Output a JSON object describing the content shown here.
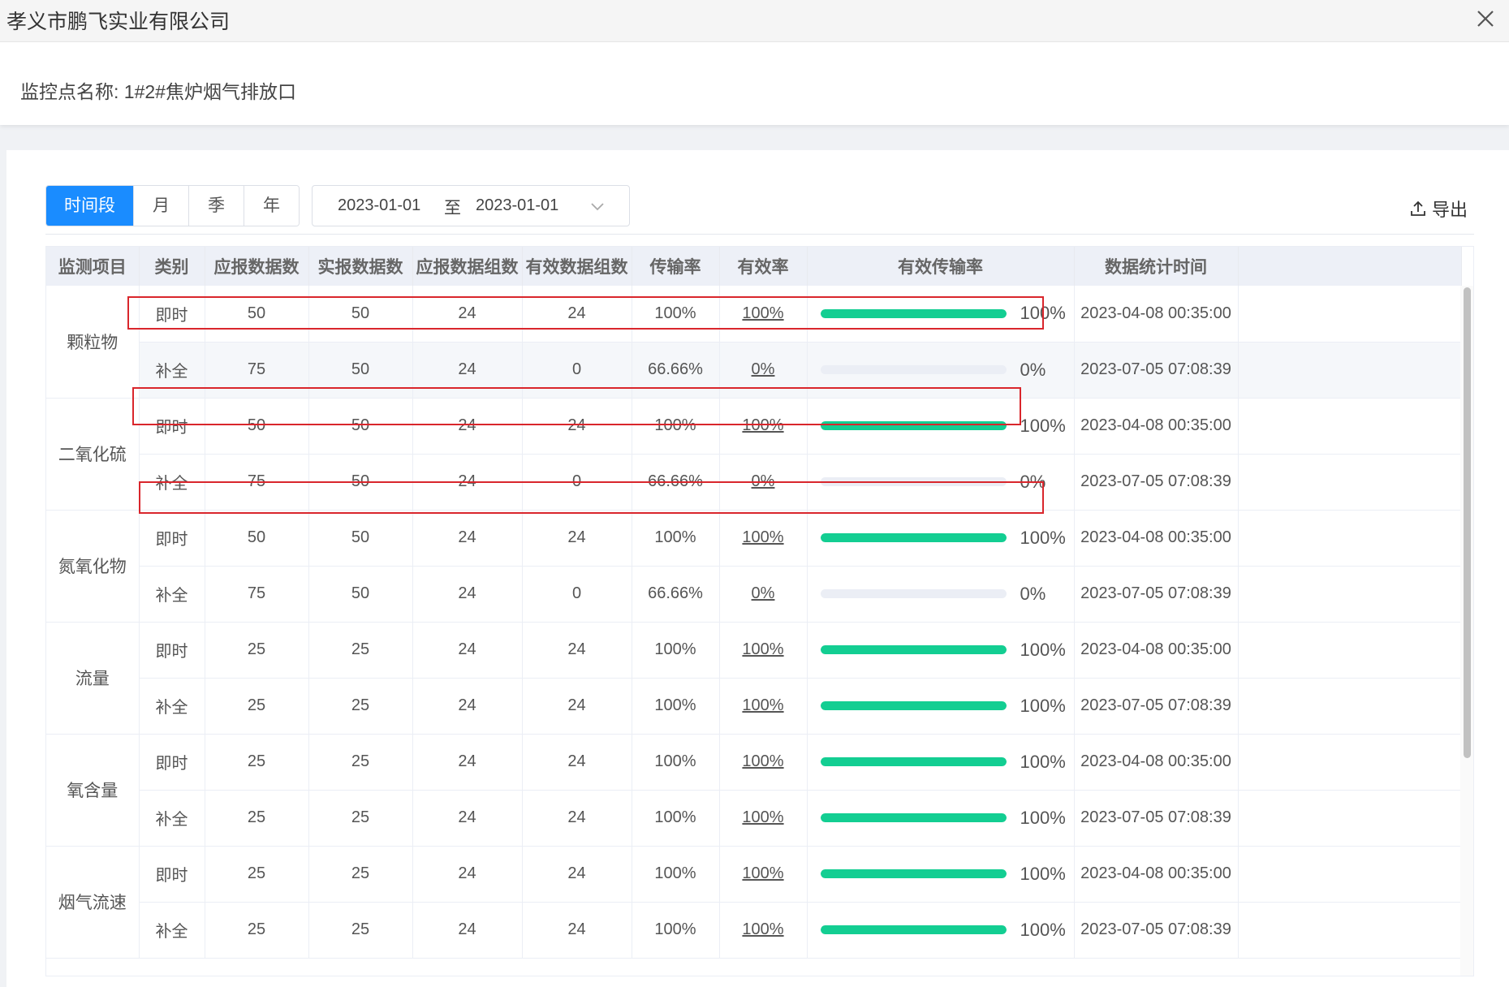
{
  "window": {
    "title": "孝义市鹏飞实业有限公司"
  },
  "monitor": {
    "label": "监控点名称:  1#2#焦炉烟气排放口"
  },
  "toolbar": {
    "period_tabs": [
      "时间段",
      "月",
      "季",
      "年"
    ],
    "date_start": "2023-01-01",
    "date_separator": "至",
    "date_end": "2023-01-01",
    "export_label": "导出"
  },
  "table": {
    "headers": [
      "监测项目",
      "类别",
      "应报数据数",
      "实报数据数",
      "应报数据组数",
      "有效数据组数",
      "传输率",
      "有效率",
      "有效传输率",
      "数据统计时间"
    ],
    "groups": [
      {
        "item": "颗粒物",
        "rows": [
          {
            "type": "即时",
            "expected": "50",
            "reported": "50",
            "expected_groups": "24",
            "valid_groups": "24",
            "transmission": "100%",
            "validity": "100%",
            "effective_pct": 100,
            "effective_text": "100%",
            "time": "2023-04-08 00:35:00"
          },
          {
            "type": "补全",
            "expected": "75",
            "reported": "50",
            "expected_groups": "24",
            "valid_groups": "0",
            "transmission": "66.66%",
            "validity": "0%",
            "effective_pct": 0,
            "effective_text": "0%",
            "time": "2023-07-05 07:08:39"
          }
        ]
      },
      {
        "item": "二氧化硫",
        "rows": [
          {
            "type": "即时",
            "expected": "50",
            "reported": "50",
            "expected_groups": "24",
            "valid_groups": "24",
            "transmission": "100%",
            "validity": "100%",
            "effective_pct": 100,
            "effective_text": "100%",
            "time": "2023-04-08 00:35:00"
          },
          {
            "type": "补全",
            "expected": "75",
            "reported": "50",
            "expected_groups": "24",
            "valid_groups": "0",
            "transmission": "66.66%",
            "validity": "0%",
            "effective_pct": 0,
            "effective_text": "0%",
            "time": "2023-07-05 07:08:39"
          }
        ]
      },
      {
        "item": "氮氧化物",
        "rows": [
          {
            "type": "即时",
            "expected": "50",
            "reported": "50",
            "expected_groups": "24",
            "valid_groups": "24",
            "transmission": "100%",
            "validity": "100%",
            "effective_pct": 100,
            "effective_text": "100%",
            "time": "2023-04-08 00:35:00"
          },
          {
            "type": "补全",
            "expected": "75",
            "reported": "50",
            "expected_groups": "24",
            "valid_groups": "0",
            "transmission": "66.66%",
            "validity": "0%",
            "effective_pct": 0,
            "effective_text": "0%",
            "time": "2023-07-05 07:08:39"
          }
        ]
      },
      {
        "item": "流量",
        "rows": [
          {
            "type": "即时",
            "expected": "25",
            "reported": "25",
            "expected_groups": "24",
            "valid_groups": "24",
            "transmission": "100%",
            "validity": "100%",
            "effective_pct": 100,
            "effective_text": "100%",
            "time": "2023-04-08 00:35:00"
          },
          {
            "type": "补全",
            "expected": "25",
            "reported": "25",
            "expected_groups": "24",
            "valid_groups": "24",
            "transmission": "100%",
            "validity": "100%",
            "effective_pct": 100,
            "effective_text": "100%",
            "time": "2023-07-05 07:08:39"
          }
        ]
      },
      {
        "item": "氧含量",
        "rows": [
          {
            "type": "即时",
            "expected": "25",
            "reported": "25",
            "expected_groups": "24",
            "valid_groups": "24",
            "transmission": "100%",
            "validity": "100%",
            "effective_pct": 100,
            "effective_text": "100%",
            "time": "2023-04-08 00:35:00"
          },
          {
            "type": "补全",
            "expected": "25",
            "reported": "25",
            "expected_groups": "24",
            "valid_groups": "24",
            "transmission": "100%",
            "validity": "100%",
            "effective_pct": 100,
            "effective_text": "100%",
            "time": "2023-07-05 07:08:39"
          }
        ]
      },
      {
        "item": "烟气流速",
        "rows": [
          {
            "type": "即时",
            "expected": "25",
            "reported": "25",
            "expected_groups": "24",
            "valid_groups": "24",
            "transmission": "100%",
            "validity": "100%",
            "effective_pct": 100,
            "effective_text": "100%",
            "time": "2023-04-08 00:35:00"
          },
          {
            "type": "补全",
            "expected": "25",
            "reported": "25",
            "expected_groups": "24",
            "valid_groups": "24",
            "transmission": "100%",
            "validity": "100%",
            "effective_pct": 100,
            "effective_text": "100%",
            "time": "2023-07-05 07:08:39"
          }
        ]
      }
    ]
  },
  "colors": {
    "accent": "#1a8cff",
    "bar_fill": "#13ce92",
    "bar_track": "#ebeef5",
    "annotation_box": "#d9262c"
  },
  "icons": {
    "close": "close-icon",
    "export": "upload-icon",
    "dropdown": "chevron-down-icon"
  }
}
